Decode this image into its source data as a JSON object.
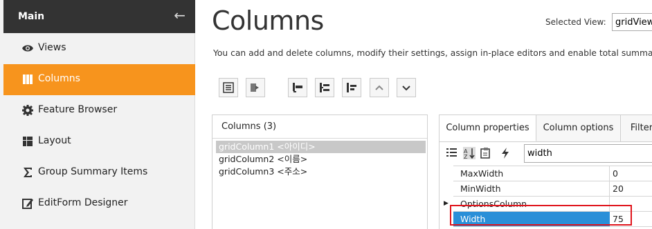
{
  "sidebar": {
    "title": "Main",
    "items": [
      {
        "label": "Views",
        "icon": "eye-icon",
        "active": false
      },
      {
        "label": "Columns",
        "icon": "columns-icon",
        "active": true
      },
      {
        "label": "Feature Browser",
        "icon": "gear-icon",
        "active": false
      },
      {
        "label": "Layout",
        "icon": "layout-icon",
        "active": false
      },
      {
        "label": "Group Summary Items",
        "icon": "sigma-icon",
        "active": false
      },
      {
        "label": "EditForm Designer",
        "icon": "edit-icon",
        "active": false
      }
    ]
  },
  "header": {
    "title": "Columns",
    "selected_view_label": "Selected View:",
    "selected_view_value": "gridView"
  },
  "description": "You can add and delete columns, modify their settings, assign in-place editors and enable total summa",
  "columns_panel": {
    "title": "Columns (3)",
    "items": [
      "gridColumn1 <아이디>",
      "gridColumn2 <이름>",
      "gridColumn3 <주소>"
    ]
  },
  "properties_panel": {
    "tabs": [
      "Column properties",
      "Column options",
      "Filter"
    ],
    "search_value": "width",
    "rows": [
      {
        "name": "MaxWidth",
        "value": "0"
      },
      {
        "name": "MinWidth",
        "value": "20"
      },
      {
        "name": "OptionsColumn",
        "value": ""
      },
      {
        "name": "Width",
        "value": "75"
      }
    ]
  },
  "colors": {
    "accent": "#f7941d",
    "sidebar_header": "#333333",
    "selection_blue": "#2a8fd8",
    "highlight_red": "#e0141c"
  }
}
